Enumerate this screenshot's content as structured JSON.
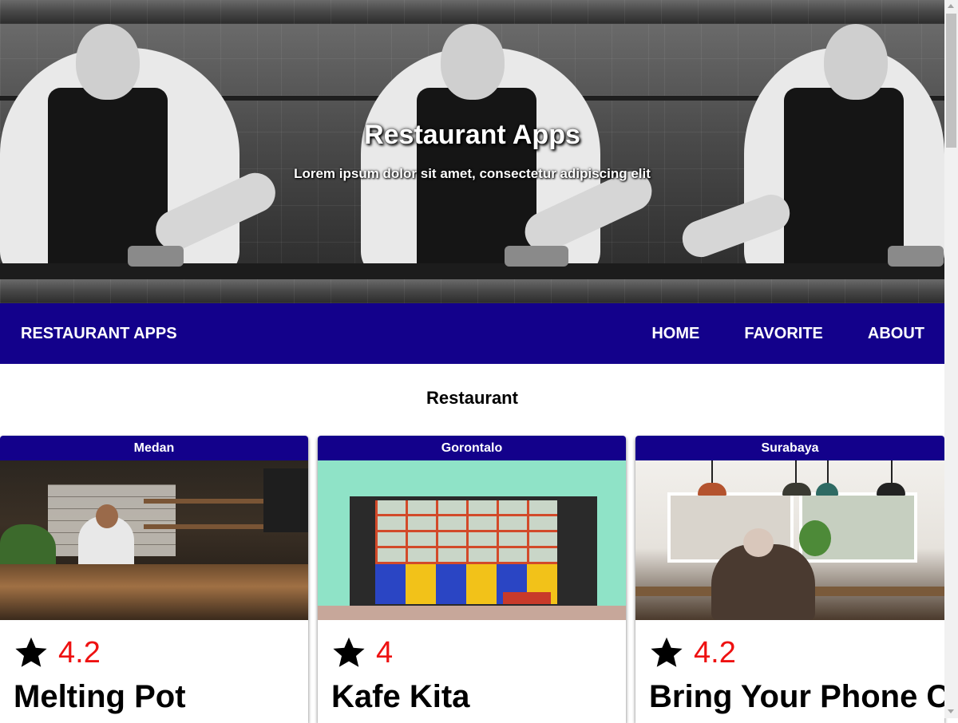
{
  "hero": {
    "title": "Restaurant Apps",
    "subtitle": "Lorem ipsum dolor sit amet, consectetur adipiscing elit"
  },
  "nav": {
    "brand": "RESTAURANT APPS",
    "links": [
      "HOME",
      "FAVORITE",
      "ABOUT"
    ]
  },
  "main": {
    "section_title": "Restaurant",
    "restaurants": [
      {
        "city": "Medan",
        "rating": "4.2",
        "name": "Melting Pot"
      },
      {
        "city": "Gorontalo",
        "rating": "4",
        "name": "Kafe Kita"
      },
      {
        "city": "Surabaya",
        "rating": "4.2",
        "name": "Bring Your Phone Cafe"
      }
    ]
  },
  "colors": {
    "nav_background": "#13018b",
    "card_header": "#13018b",
    "rating_text": "#ee1111"
  },
  "icons": {
    "rating": "star-icon"
  }
}
